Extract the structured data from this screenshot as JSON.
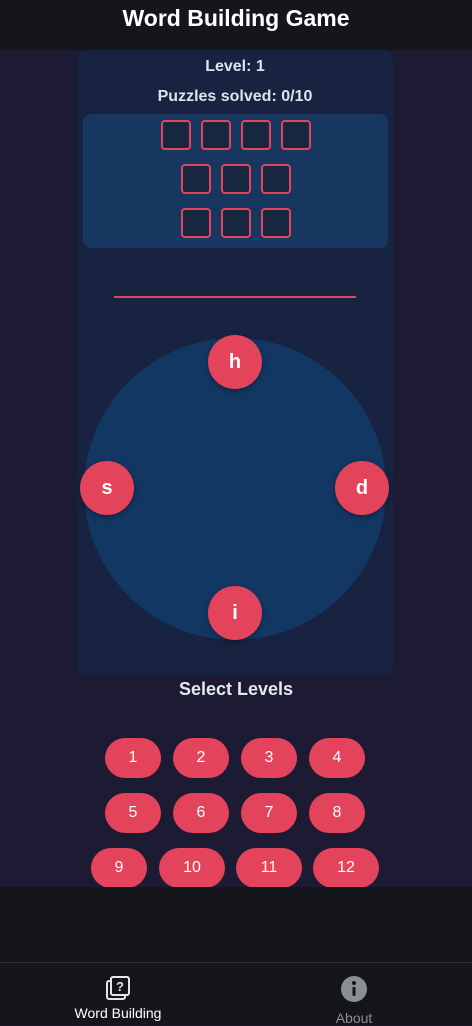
{
  "header": {
    "title": "Word Building Game"
  },
  "game": {
    "level_label": "Level: 1",
    "solved_label": "Puzzles solved: 0/10",
    "word_rows": [
      4,
      3,
      3
    ],
    "letters": [
      "h",
      "d",
      "i",
      "s"
    ]
  },
  "levels": {
    "title": "Select Levels",
    "buttons": [
      "1",
      "2",
      "3",
      "4",
      "5",
      "6",
      "7",
      "8",
      "9",
      "10",
      "11",
      "12"
    ]
  },
  "tabs": [
    {
      "label": "Word Building",
      "icon": "puzzle-question-icon",
      "active": true
    },
    {
      "label": "About",
      "icon": "info-icon",
      "active": false
    }
  ],
  "colors": {
    "accent": "#e4435c",
    "background": "#1c1b33",
    "card": "#172340",
    "wheel": "#133763",
    "header": "#14161b"
  }
}
